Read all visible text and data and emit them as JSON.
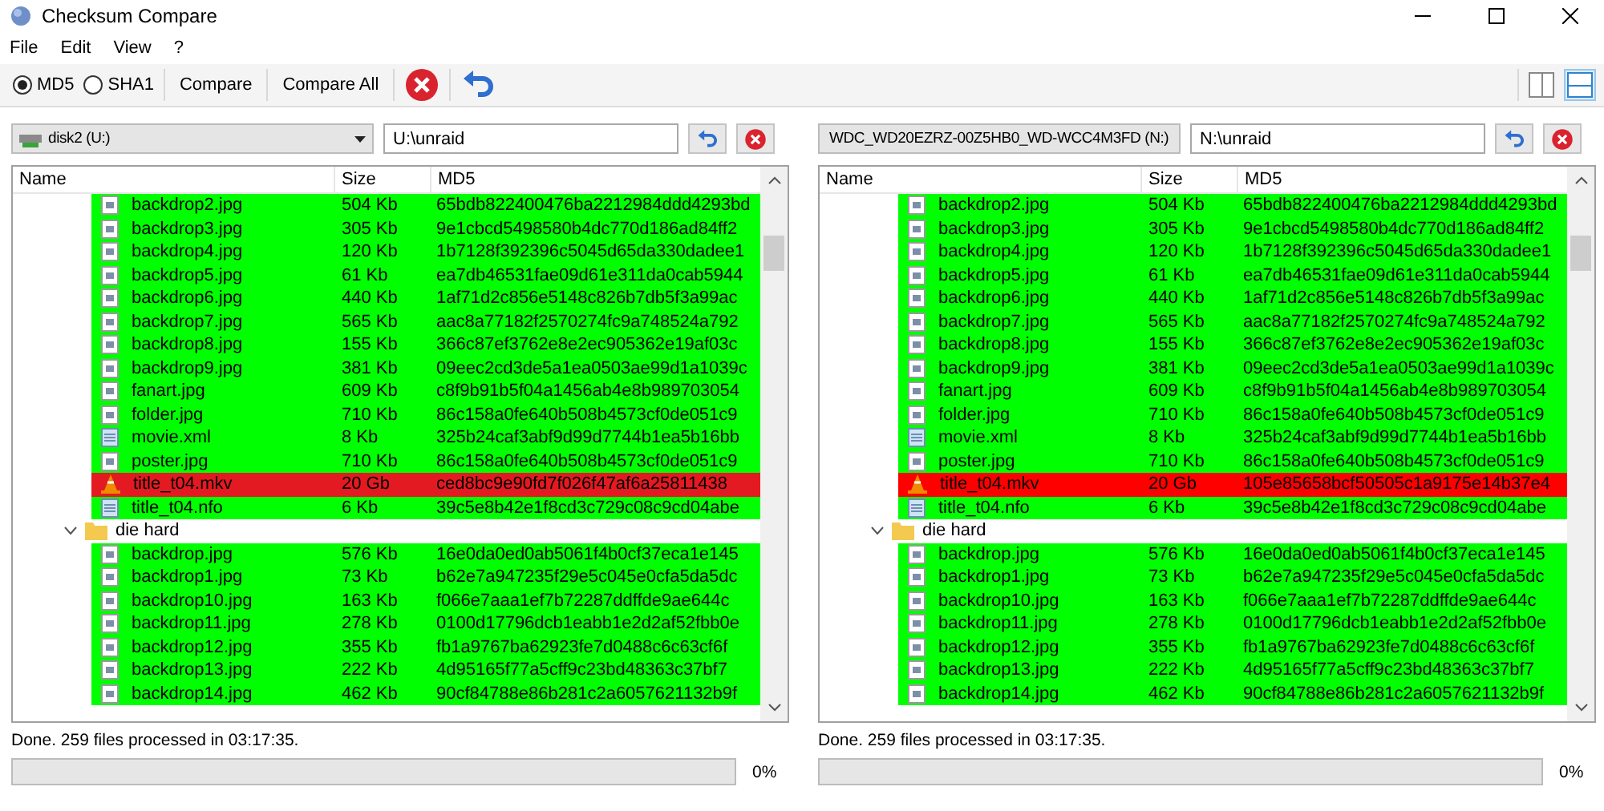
{
  "window": {
    "title": "Checksum Compare"
  },
  "menu": [
    "File",
    "Edit",
    "View",
    "?"
  ],
  "toolbar": {
    "algorithms": [
      {
        "label": "MD5",
        "selected": true
      },
      {
        "label": "SHA1",
        "selected": false
      }
    ],
    "buttons": [
      "Compare",
      "Compare All"
    ],
    "layout_buttons": [
      {
        "selected": false
      },
      {
        "selected": true
      }
    ]
  },
  "panes": [
    {
      "drive": "disk2 (U:)",
      "path": "U:\\unraid",
      "columns": [
        "Name",
        "Size",
        "MD5"
      ],
      "rows": [
        {
          "kind": "image",
          "name": "backdrop2.jpg",
          "size": "504 Kb",
          "hash": "65bdb822400476ba2212984ddd4293bd",
          "color": "#00ff00"
        },
        {
          "kind": "image",
          "name": "backdrop3.jpg",
          "size": "305 Kb",
          "hash": "9e1cbcd5498580b4dc770d186ad84ff2",
          "color": "#00ff00"
        },
        {
          "kind": "image",
          "name": "backdrop4.jpg",
          "size": "120 Kb",
          "hash": "1b7128f392396c5045d65da330dadee1",
          "color": "#00ff00"
        },
        {
          "kind": "image",
          "name": "backdrop5.jpg",
          "size": "61 Kb",
          "hash": "ea7db46531fae09d61e311da0cab5944",
          "color": "#00ff00"
        },
        {
          "kind": "image",
          "name": "backdrop6.jpg",
          "size": "440 Kb",
          "hash": "1af71d2c856e5148c826b7db5f3a99ac",
          "color": "#00ff00"
        },
        {
          "kind": "image",
          "name": "backdrop7.jpg",
          "size": "565 Kb",
          "hash": "aac8a77182f2570274fc9a748524a792",
          "color": "#00ff00"
        },
        {
          "kind": "image",
          "name": "backdrop8.jpg",
          "size": "155 Kb",
          "hash": "366c87ef3762e8e2ec905362e19af03c",
          "color": "#00ff00"
        },
        {
          "kind": "image",
          "name": "backdrop9.jpg",
          "size": "381 Kb",
          "hash": "09eec2cd3de5a1ea0503ae99d1a1039c",
          "color": "#00ff00"
        },
        {
          "kind": "image",
          "name": "fanart.jpg",
          "size": "609 Kb",
          "hash": "c8f9b91b5f04a1456ab4e8b989703054",
          "color": "#00ff00"
        },
        {
          "kind": "image",
          "name": "folder.jpg",
          "size": "710 Kb",
          "hash": "86c158a0fe640b508b4573cf0de051c9",
          "color": "#00ff00"
        },
        {
          "kind": "text",
          "name": "movie.xml",
          "size": "8 Kb",
          "hash": "325b24caf3abf9d99d7744b1ea5b16bb",
          "color": "#00ff00"
        },
        {
          "kind": "image",
          "name": "poster.jpg",
          "size": "710 Kb",
          "hash": "86c158a0fe640b508b4573cf0de051c9",
          "color": "#00ff00"
        },
        {
          "kind": "video",
          "name": "title_t04.mkv",
          "size": "20 Gb",
          "hash": "ced8bc9e90fd7f026f47af6a25811438",
          "color": "#e31a21"
        },
        {
          "kind": "text",
          "name": "title_t04.nfo",
          "size": "6 Kb",
          "hash": "39c5e8b42e1f8cd3c729c08c9cd04abe",
          "color": "#00ff00"
        },
        {
          "kind": "folder",
          "name": "die hard",
          "expanded": true,
          "children": [
            {
              "kind": "image",
              "name": "backdrop.jpg",
              "size": "576 Kb",
              "hash": "16e0da0ed0ab5061f4b0cf37eca1e145",
              "color": "#00ff00"
            },
            {
              "kind": "image",
              "name": "backdrop1.jpg",
              "size": "73 Kb",
              "hash": "b62e7a947235f29e5c045e0cfa5da5dc",
              "color": "#00ff00"
            },
            {
              "kind": "image",
              "name": "backdrop10.jpg",
              "size": "163 Kb",
              "hash": "f066e7aaa1ef7b72287ddffde9ae644c",
              "color": "#00ff00"
            },
            {
              "kind": "image",
              "name": "backdrop11.jpg",
              "size": "278 Kb",
              "hash": "0100d17796dcb1eabb1e2d2af52fbb0e",
              "color": "#00ff00"
            },
            {
              "kind": "image",
              "name": "backdrop12.jpg",
              "size": "355 Kb",
              "hash": "fb1a9767ba62923fe7d0488c6c63cf6f",
              "color": "#00ff00"
            },
            {
              "kind": "image",
              "name": "backdrop13.jpg",
              "size": "222 Kb",
              "hash": "4d95165f77a5cff9c23bd48363c37bf7",
              "color": "#00ff00"
            },
            {
              "kind": "image",
              "name": "backdrop14.jpg",
              "size": "462 Kb",
              "hash": "90cf84788e86b281c2a6057621132b9f",
              "color": "#00ff00"
            }
          ]
        }
      ],
      "status": "Done. 259 files processed in 03:17:35.",
      "progress": {
        "level": 0,
        "reading": "0%"
      }
    },
    {
      "drive": "WDC_WD20EZRZ-00Z5HB0_WD-WCC4M3FD (N:)",
      "path": "N:\\unraid",
      "columns": [
        "Name",
        "Size",
        "MD5"
      ],
      "rows": [
        {
          "kind": "image",
          "name": "backdrop2.jpg",
          "size": "504 Kb",
          "hash": "65bdb822400476ba2212984ddd4293bd",
          "color": "#00ff00"
        },
        {
          "kind": "image",
          "name": "backdrop3.jpg",
          "size": "305 Kb",
          "hash": "9e1cbcd5498580b4dc770d186ad84ff2",
          "color": "#00ff00"
        },
        {
          "kind": "image",
          "name": "backdrop4.jpg",
          "size": "120 Kb",
          "hash": "1b7128f392396c5045d65da330dadee1",
          "color": "#00ff00"
        },
        {
          "kind": "image",
          "name": "backdrop5.jpg",
          "size": "61 Kb",
          "hash": "ea7db46531fae09d61e311da0cab5944",
          "color": "#00ff00"
        },
        {
          "kind": "image",
          "name": "backdrop6.jpg",
          "size": "440 Kb",
          "hash": "1af71d2c856e5148c826b7db5f3a99ac",
          "color": "#00ff00"
        },
        {
          "kind": "image",
          "name": "backdrop7.jpg",
          "size": "565 Kb",
          "hash": "aac8a77182f2570274fc9a748524a792",
          "color": "#00ff00"
        },
        {
          "kind": "image",
          "name": "backdrop8.jpg",
          "size": "155 Kb",
          "hash": "366c87ef3762e8e2ec905362e19af03c",
          "color": "#00ff00"
        },
        {
          "kind": "image",
          "name": "backdrop9.jpg",
          "size": "381 Kb",
          "hash": "09eec2cd3de5a1ea0503ae99d1a1039c",
          "color": "#00ff00"
        },
        {
          "kind": "image",
          "name": "fanart.jpg",
          "size": "609 Kb",
          "hash": "c8f9b91b5f04a1456ab4e8b989703054",
          "color": "#00ff00"
        },
        {
          "kind": "image",
          "name": "folder.jpg",
          "size": "710 Kb",
          "hash": "86c158a0fe640b508b4573cf0de051c9",
          "color": "#00ff00"
        },
        {
          "kind": "text",
          "name": "movie.xml",
          "size": "8 Kb",
          "hash": "325b24caf3abf9d99d7744b1ea5b16bb",
          "color": "#00ff00"
        },
        {
          "kind": "image",
          "name": "poster.jpg",
          "size": "710 Kb",
          "hash": "86c158a0fe640b508b4573cf0de051c9",
          "color": "#00ff00"
        },
        {
          "kind": "video",
          "name": "title_t04.mkv",
          "size": "20 Gb",
          "hash": "105e85658bcf50505c1a9175e14b37e4",
          "color": "#ff0000"
        },
        {
          "kind": "text",
          "name": "title_t04.nfo",
          "size": "6 Kb",
          "hash": "39c5e8b42e1f8cd3c729c08c9cd04abe",
          "color": "#00ff00"
        },
        {
          "kind": "folder",
          "name": "die hard",
          "expanded": true,
          "children": [
            {
              "kind": "image",
              "name": "backdrop.jpg",
              "size": "576 Kb",
              "hash": "16e0da0ed0ab5061f4b0cf37eca1e145",
              "color": "#00ff00"
            },
            {
              "kind": "image",
              "name": "backdrop1.jpg",
              "size": "73 Kb",
              "hash": "b62e7a947235f29e5c045e0cfa5da5dc",
              "color": "#00ff00"
            },
            {
              "kind": "image",
              "name": "backdrop10.jpg",
              "size": "163 Kb",
              "hash": "f066e7aaa1ef7b72287ddffde9ae644c",
              "color": "#00ff00"
            },
            {
              "kind": "image",
              "name": "backdrop11.jpg",
              "size": "278 Kb",
              "hash": "0100d17796dcb1eabb1e2d2af52fbb0e",
              "color": "#00ff00"
            },
            {
              "kind": "image",
              "name": "backdrop12.jpg",
              "size": "355 Kb",
              "hash": "fb1a9767ba62923fe7d0488c6c63cf6f",
              "color": "#00ff00"
            },
            {
              "kind": "image",
              "name": "backdrop13.jpg",
              "size": "222 Kb",
              "hash": "4d95165f77a5cff9c23bd48363c37bf7",
              "color": "#00ff00"
            },
            {
              "kind": "image",
              "name": "backdrop14.jpg",
              "size": "462 Kb",
              "hash": "90cf84788e86b281c2a6057621132b9f",
              "color": "#00ff00"
            }
          ]
        }
      ],
      "status": "Done. 259 files processed in 03:17:35.",
      "progress": {
        "level": 0,
        "reading": "0%"
      }
    }
  ]
}
